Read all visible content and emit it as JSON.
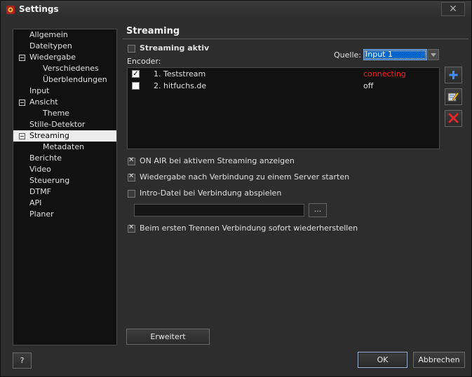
{
  "window": {
    "title": "Settings",
    "close_label": "✕"
  },
  "nav": {
    "items": [
      {
        "label": "Allgemein",
        "level": 1
      },
      {
        "label": "Dateitypen",
        "level": 1
      },
      {
        "label": "Wiedergabe",
        "level": 1,
        "expanded": true
      },
      {
        "label": "Verschiedenes",
        "level": 2
      },
      {
        "label": "Überblendungen",
        "level": 2
      },
      {
        "label": "Input",
        "level": 1
      },
      {
        "label": "Ansicht",
        "level": 1,
        "expanded": true
      },
      {
        "label": "Theme",
        "level": 2
      },
      {
        "label": "Stille-Detektor",
        "level": 1
      },
      {
        "label": "Streaming",
        "level": 1,
        "expanded": true,
        "selected": true
      },
      {
        "label": "Metadaten",
        "level": 2
      },
      {
        "label": "Berichte",
        "level": 1
      },
      {
        "label": "Video",
        "level": 1
      },
      {
        "label": "Steuerung",
        "level": 1
      },
      {
        "label": "DTMF",
        "level": 1
      },
      {
        "label": "API",
        "level": 1
      },
      {
        "label": "Planer",
        "level": 1
      }
    ]
  },
  "streaming": {
    "section_title": "Streaming",
    "enable_label": "Streaming aktiv",
    "enable_checked": false,
    "encoder_label": "Encoder:",
    "source_label": "Quelle:",
    "source_value": "Input 1",
    "encoders": [
      {
        "name": "1. Teststream",
        "status": "connecting",
        "checked": true
      },
      {
        "name": "2. hitfuchs.de",
        "status": "off",
        "checked": false
      }
    ],
    "options": [
      {
        "label": "ON AIR bei aktivem Streaming anzeigen",
        "checked": true
      },
      {
        "label": "Wiedergabe nach Verbindung zu einem Server starten",
        "checked": true
      },
      {
        "label": "Intro-Datei bei Verbindung abspielen",
        "checked": false
      },
      {
        "label": "Beim ersten Trennen Verbindung sofort wiederherstellen",
        "checked": true
      }
    ],
    "intro_file_value": "",
    "browse_label": "...",
    "advanced_label": "Erweitert"
  },
  "footer": {
    "help_label": "?",
    "ok_label": "OK",
    "cancel_label": "Abbrechen"
  },
  "colors": {
    "status_connecting": "#ff2020",
    "selection": "#0066cc"
  }
}
